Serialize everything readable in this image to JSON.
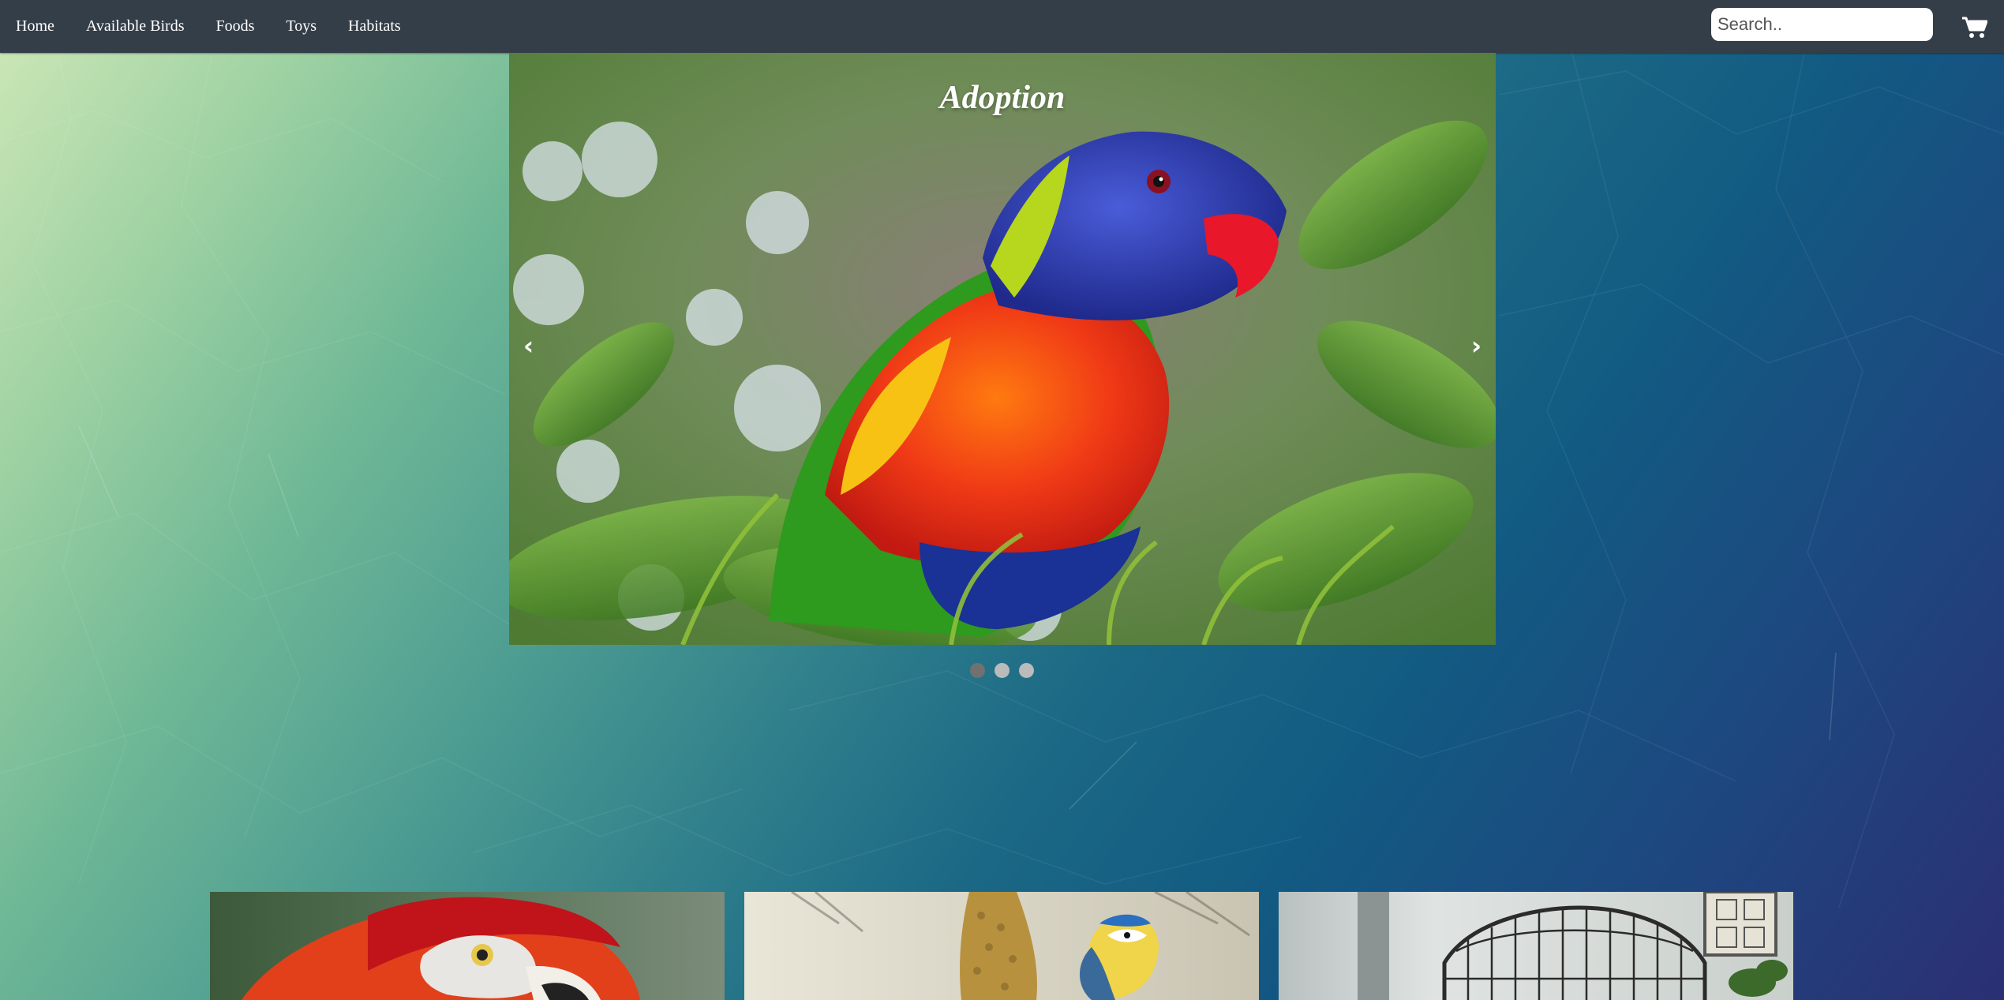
{
  "nav": {
    "links": [
      "Home",
      "Available Birds",
      "Foods",
      "Toys",
      "Habitats"
    ]
  },
  "search": {
    "placeholder": "Search.."
  },
  "cart": {
    "icon": "shopping-cart-icon"
  },
  "carousel": {
    "caption": "Adoption",
    "prev_arrow": "‹",
    "next_arrow": "›",
    "slide_count": 3,
    "active_slide": 1
  },
  "cards": [
    {
      "image": "scarlet-macaw-image"
    },
    {
      "image": "blue-tit-feeder-image"
    },
    {
      "image": "bird-cage-image"
    }
  ],
  "colors": {
    "navbar": "#343e48",
    "dot_active": "#717171",
    "dot_inactive": "#bbbbbb"
  }
}
